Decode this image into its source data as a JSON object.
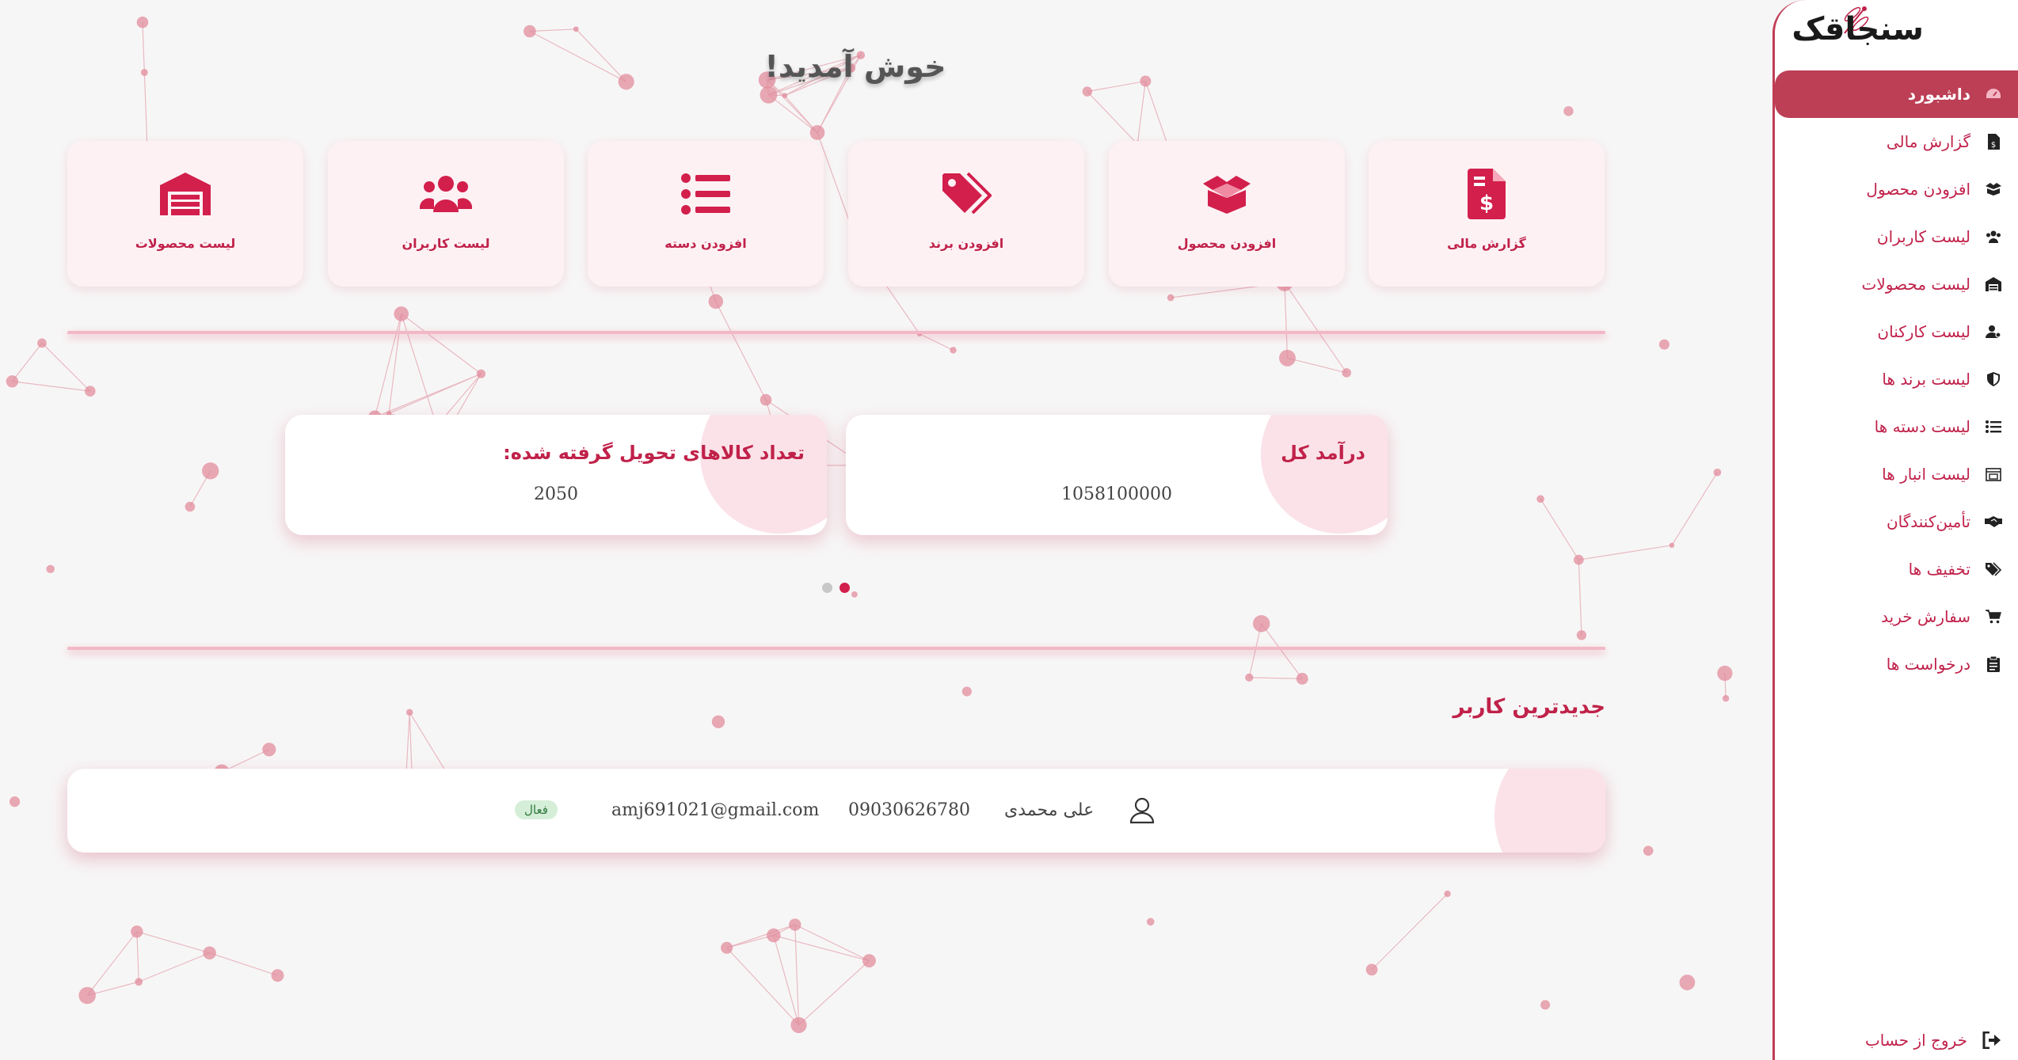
{
  "brand": {
    "logo_text": "سنجاقک",
    "accent": "#c0224a",
    "active_bg": "#bc3f56"
  },
  "sidebar": {
    "items": [
      {
        "label": "داشبورد",
        "icon": "dashboard-icon",
        "active": true
      },
      {
        "label": "گزارش مالی",
        "icon": "invoice-dollar-icon"
      },
      {
        "label": "افزودن محصول",
        "icon": "box-open-icon"
      },
      {
        "label": "لیست کاربران",
        "icon": "users-icon"
      },
      {
        "label": "لیست محصولات",
        "icon": "warehouse-icon"
      },
      {
        "label": "لیست کارکنان",
        "icon": "user-gear-icon"
      },
      {
        "label": "لیست برند ها",
        "icon": "shield-icon"
      },
      {
        "label": "لیست دسته ها",
        "icon": "list-icon"
      },
      {
        "label": "لیست انبار ها",
        "icon": "store-icon"
      },
      {
        "label": "تأمین‌کنندگان",
        "icon": "handshake-icon"
      },
      {
        "label": "تخفیف ها",
        "icon": "tags-icon"
      },
      {
        "label": "سفارش خرید",
        "icon": "cart-icon"
      },
      {
        "label": "درخواست ها",
        "icon": "clipboard-icon"
      }
    ],
    "logout_label": "خروج از حساب"
  },
  "main": {
    "welcome": "خوش آمدید!",
    "quick_links": [
      {
        "label": "گزارش مالی",
        "icon": "invoice-dollar-icon"
      },
      {
        "label": "افزودن محصول",
        "icon": "box-open-icon"
      },
      {
        "label": "افزودن برند",
        "icon": "tag-icon"
      },
      {
        "label": "افزودن دسته",
        "icon": "list-icon"
      },
      {
        "label": "لیست کاربران",
        "icon": "users-icon"
      },
      {
        "label": "لیست محصولات",
        "icon": "warehouse-icon"
      }
    ],
    "stats": [
      {
        "title": "درآمد کل",
        "value": "1058100000"
      },
      {
        "title": "تعداد کالاهای تحویل گرفته شده:",
        "value": "2050"
      }
    ],
    "carousel": {
      "pages": 2,
      "active_index": 0
    },
    "latest_user": {
      "section_title": "جدیدترین کاربر",
      "name": "علی محمدی",
      "phone": "09030626780",
      "email": "amj691021@gmail.com",
      "status": "فعال"
    }
  }
}
